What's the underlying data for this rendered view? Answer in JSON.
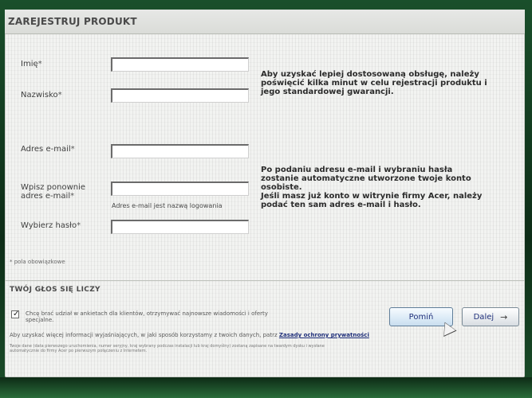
{
  "page": {
    "header_title": "ZAREJESTRUJ PRODUKT",
    "required_marker": "*",
    "required_note": "* pola obowiązkowe"
  },
  "form": {
    "first_name": {
      "label": "Imię",
      "value": ""
    },
    "last_name": {
      "label": "Nazwisko",
      "value": ""
    },
    "email": {
      "label": "Adres e-mail",
      "value": ""
    },
    "email_repeat": {
      "label_line1": "Wpisz ponownie",
      "label_line2": "adres e-mail",
      "value": ""
    },
    "email_login_hint": "Adres e-mail jest nazwą logowania",
    "password": {
      "label": "Wybierz hasło",
      "value": ""
    }
  },
  "info": {
    "block1": [
      "Aby uzyskać lepiej dostosowaną obsługę, należy",
      "poświęcić kilka minut w celu rejestracji produktu i",
      "jego standardowej gwarancji."
    ],
    "block2": [
      "Po podaniu adresu e-mail i wybraniu hasła",
      "zostanie automatyczne utworzone twoje konto",
      "osobiste.",
      "Jeśli masz już konto w witrynie firmy Acer, należy",
      "podać ten sam adres e-mail i hasło."
    ]
  },
  "voice": {
    "title": "TWÓJ GŁOS SIĘ LICZY",
    "checkbox_checked": true,
    "checkbox_text_line1": "Chcę brać udział w ankietach dla klientów, otrzymywać najnowsze wiadomości i oferty",
    "checkbox_text_line2": "specjalne.",
    "privacy_text": "Aby uzyskać więcej informacji wyjaśniających, w jaki sposób korzystamy z twoich danych, patrz",
    "privacy_link": "Zasady ochrony prywatności",
    "fine_print_line1": "Twoje dane (data pierwszego uruchomienia, numer seryjny, kraj wybrany podczas instalacji lub kraj domyślny) zostaną zapisane na twardym dysku i wysłane",
    "fine_print_line2": "automatycznie do firmy Acer po pierwszym połączeniu z Internetem."
  },
  "buttons": {
    "skip": "Pomiń",
    "next": "Dalej",
    "next_arrow_icon": "arrow-right-icon"
  },
  "colors": {
    "panel_bg": "#f2f3f1",
    "link_blue": "#1f2f7a",
    "wallpaper_green": "#1a4f2b"
  }
}
